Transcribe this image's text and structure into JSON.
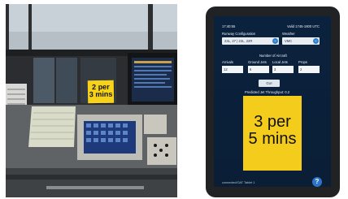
{
  "photo_sticky_note": {
    "line1": "2 per",
    "line2": "3 mins"
  },
  "tablet": {
    "clock": "17:40:55",
    "valid": "Valid 1745-1800 UTC",
    "runway_configuration_label": "Runway Configuration",
    "runway_configuration_value": "23L, 27 | 22L, 22R",
    "weather_label": "Weather",
    "weather_value": "VMC",
    "number_of_aircraft_label": "Number of Aircraft",
    "columns": [
      "Arrivals",
      "Ground Jets",
      "Local Jets",
      "Props"
    ],
    "values": [
      "12",
      "6",
      "3",
      "2"
    ],
    "go_label": "Go!",
    "predicted_label": "Predicted Jet Throughput: 0.2",
    "predicted_line1": "3 per",
    "predicted_line2": "5 mins",
    "help_icon_label": "?",
    "footer": "connected/OAT Tablet 1"
  }
}
